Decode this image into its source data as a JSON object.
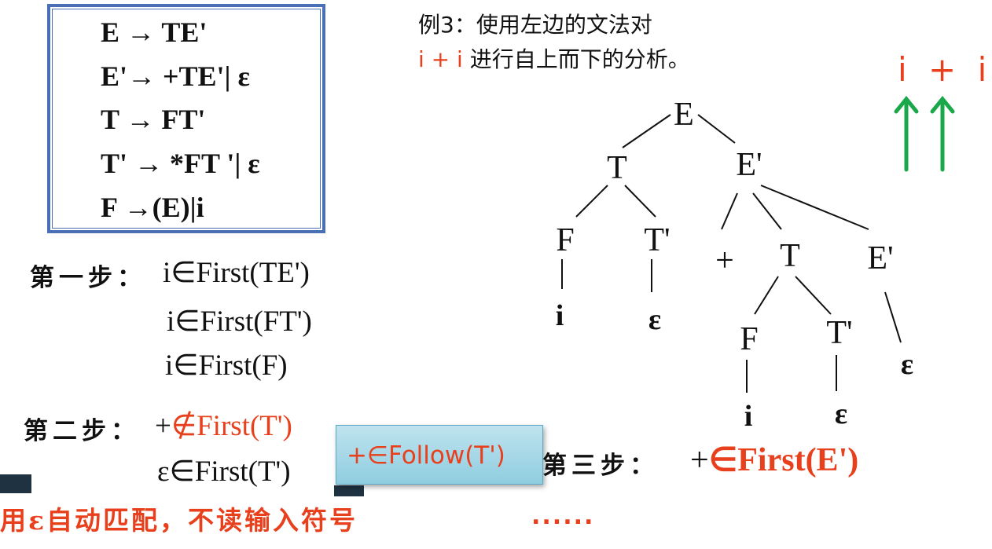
{
  "grammar": {
    "rules": [
      "E → TE'",
      "E'→ +TE'| ε",
      "T → FT'",
      "T' → *FT '| ε",
      "F →(E)|i"
    ]
  },
  "example": {
    "title": "例3：使用左边的文法对",
    "input_highlight": "i + i",
    "line2_rest": "进行自上而下的分析。"
  },
  "input_tape": {
    "symbols": [
      "i",
      "+",
      "i"
    ],
    "accent": "#e8401c",
    "arrow_color": "#1aa84a"
  },
  "step1": {
    "label": "第一步：",
    "lines": [
      "i∈First(TE')",
      "i∈First(FT')",
      "i∈First(F)"
    ]
  },
  "step2": {
    "label": "第二步：",
    "line1_prefix": "+",
    "line1_red": "∉First(T')",
    "line2": "ε∈First(T')"
  },
  "follow_box": {
    "text": "+∈Follow(T')"
  },
  "step3": {
    "label": "第三步：",
    "prefix": "+",
    "red": "∈First(E')"
  },
  "tree": {
    "nodes": [
      "E",
      "T",
      "E'",
      "F",
      "T'",
      "+",
      "T",
      "E'",
      "i",
      "ε",
      "F",
      "T'",
      "ε",
      "i",
      "ε"
    ]
  },
  "bottom_note": "用ε自动匹配，不读输入符号",
  "bottom_dots": "......",
  "colors": {
    "accent_red": "#e8401c",
    "box_border": "#4a6fb4",
    "arrow_green": "#1aa84a",
    "follow_bg": "#a8d8e8"
  }
}
